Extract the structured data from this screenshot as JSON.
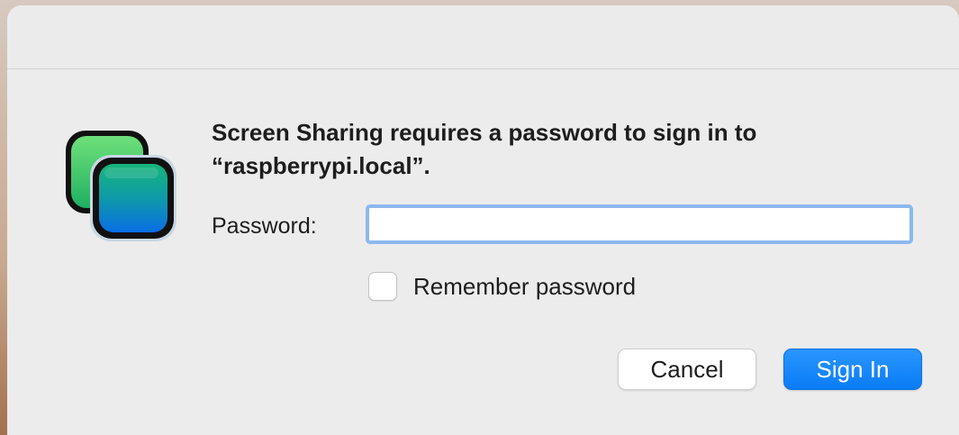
{
  "dialog": {
    "app_icon": "screen-sharing-icon",
    "message": "Screen Sharing requires a password to sign in to “raspberrypi.local”.",
    "password_label": "Password:",
    "password_value": "",
    "password_placeholder": "",
    "remember_label": "Remember password",
    "remember_checked": false,
    "cancel_label": "Cancel",
    "signin_label": "Sign In"
  },
  "colors": {
    "accent": "#0a7cf5",
    "focus_ring": "#8db8ee",
    "dialog_background": "#ececec"
  }
}
